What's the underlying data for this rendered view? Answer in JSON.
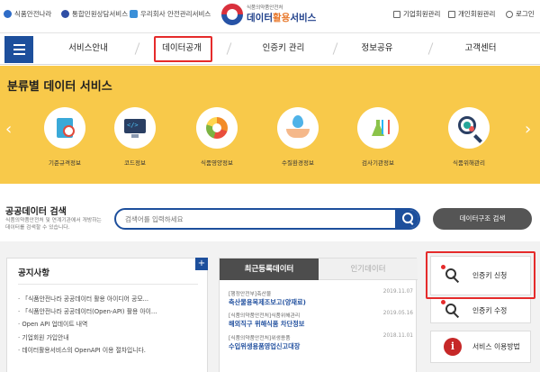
{
  "topbar": {
    "util_links": [
      "식품안전나라",
      "통합민원상담서비스",
      "우리회사 안전관리서비스"
    ],
    "logo_small": "식품의약품안전처",
    "logo_main_a": "데이터",
    "logo_main_b": "활용",
    "logo_main_c": "서비스",
    "right_links": [
      "기업회원관리",
      "개인회원관리",
      "로그인"
    ]
  },
  "nav": {
    "items": [
      "서비스안내",
      "데이터공개",
      "인증키 관리",
      "정보공유",
      "고객센터"
    ],
    "highlighted": "데이터공개"
  },
  "banner": {
    "title": "분류별 데이터 서비스",
    "categories": [
      {
        "label": "기준규격정보",
        "icon": "book-magnifier-icon"
      },
      {
        "label": "코드정보",
        "icon": "monitor-code-icon"
      },
      {
        "label": "식품영양정보",
        "icon": "nutrition-pie-icon"
      },
      {
        "label": "수질환경정보",
        "icon": "water-hands-icon"
      },
      {
        "label": "검사기관정보",
        "icon": "flask-chart-icon"
      },
      {
        "label": "식품위해관리",
        "icon": "magnifier-bacteria-icon"
      }
    ],
    "prev_arrow": "‹",
    "next_arrow": "›",
    "background": "#f8c94a"
  },
  "search": {
    "title": "공공데이터 검색",
    "description": "식품의약품안전처 및 연계기관에서 개방하는 데이터를 검색할 수 있습니다.",
    "placeholder": "검색어를 입력하세요",
    "struct_button": "데이터구조 검색"
  },
  "notice": {
    "title": "공지사항",
    "plus": "+",
    "items": [
      "「식품안전나라 공공데이터 활용 아이디어 공모...",
      "「식품안전나라 공공데이터(Open-API) 활용 아이...",
      "Open API 업데이트 내역",
      "기업회원 가입안내",
      "데이터활용서비스의 OpenAPI 이용 절차입니다."
    ]
  },
  "recent": {
    "tab_active": "최근등록데이터",
    "tab_inactive": "인기데이터",
    "items": [
      {
        "source": "[행정안전부]축산물",
        "title": "축산물용목제조보고(양재료)",
        "date": "2019.11.07"
      },
      {
        "source": "[식품의약품안전처]식품위해관리",
        "title": "해외직구 위해식품 차단정보",
        "date": "2019.05.16"
      },
      {
        "source": "[식품의약품안전처]위생용품",
        "title": "수입위생용품영업신고대장",
        "date": "2018.11.01"
      }
    ]
  },
  "side": {
    "cards": [
      {
        "label": "인증키 신청",
        "icon": "key-icon"
      },
      {
        "label": "인증키 수정",
        "icon": "key-icon"
      },
      {
        "label": "서비스 이용방법",
        "icon": "info-icon"
      }
    ],
    "info_glyph": "i"
  },
  "colors": {
    "primary": "#1d4f9c",
    "highlight_box": "#e52b2b",
    "banner": "#f8c94a"
  }
}
